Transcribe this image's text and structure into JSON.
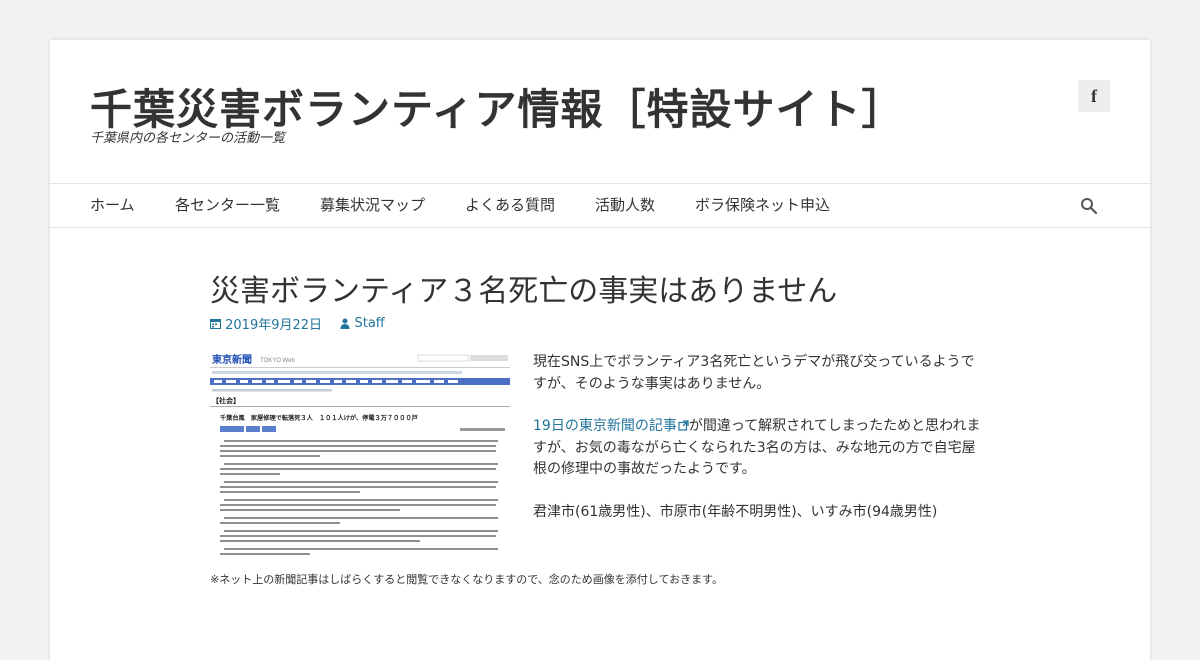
{
  "site": {
    "title": "千葉災害ボランティア情報［特設サイト］",
    "description": "千葉県内の各センターの活動一覧"
  },
  "social": {
    "facebook_icon_label": "f"
  },
  "nav": {
    "items": [
      {
        "label": "ホーム"
      },
      {
        "label": "各センター一覧"
      },
      {
        "label": "募集状況マップ"
      },
      {
        "label": "よくある質問"
      },
      {
        "label": "活動人数"
      },
      {
        "label": "ボラ保険ネット申込"
      }
    ]
  },
  "post": {
    "title": "災害ボランティア３名死亡の事実はありません",
    "date": "2019年9月22日",
    "author": "Staff",
    "paragraph1": "現在SNS上でボランティア3名死亡というデマが飛び交っているようですが、そのような事実はありません。",
    "link_text": "19日の東京新聞の記事",
    "paragraph2_rest": "が間違って解釈されてしまったためと思われますが、お気の毒ながら亡くなられた3名の方は、みな地元の方で自宅屋根の修理中の事故だったようです。",
    "paragraph3": "君津市(61歳男性)、市原市(年齢不明男性)、いすみ市(94歳男性)",
    "caption": "※ネット上の新聞記事はしばらくすると閲覧できなくなりますので、念のため画像を添付しておきます。"
  },
  "newspaper": {
    "masthead": "東京新聞",
    "web_label": "TOKYO Web",
    "section": "【社会】",
    "headline": "千葉台風　家屋修理で転落死３人　１０１人けが、停電３万７０００戸"
  },
  "colors": {
    "link": "#21759b",
    "text": "#333333",
    "newspaper_nav": "#4a6fc4"
  }
}
